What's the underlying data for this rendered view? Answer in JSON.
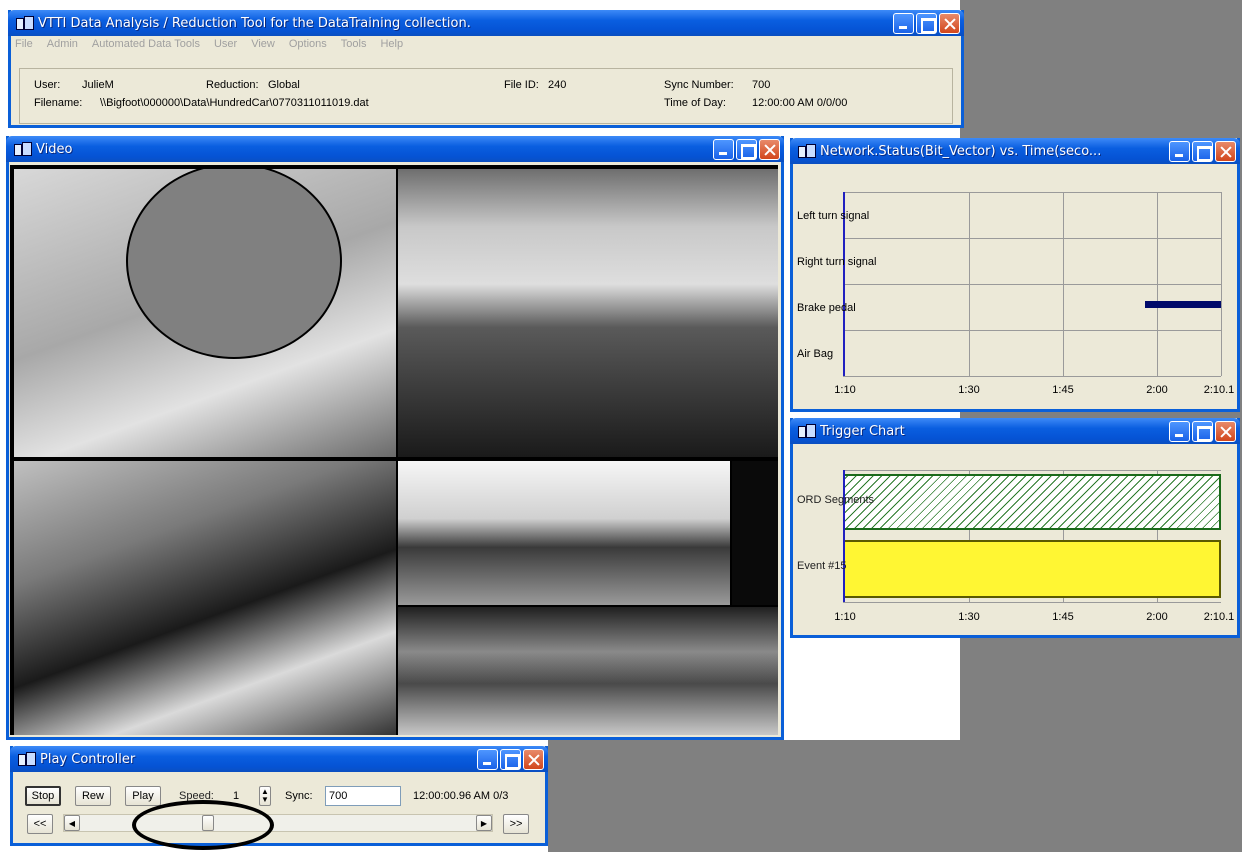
{
  "main": {
    "title": "VTTI Data Analysis / Reduction Tool for the DataTraining collection.",
    "menu": [
      "File",
      "Admin",
      "Automated Data Tools",
      "User",
      "View",
      "Options",
      "Tools",
      "Help"
    ],
    "user_label": "User:",
    "user_value": "JulieM",
    "reduction_label": "Reduction:",
    "reduction_value": "Global",
    "fileid_label": "File ID:",
    "fileid_value": "240",
    "sync_label": "Sync Number:",
    "sync_value": "700",
    "filename_label": "Filename:",
    "filename_value": "\\\\Bigfoot\\000000\\Data\\HundredCar\\0770311011019.dat",
    "tod_label": "Time of Day:",
    "tod_value": "12:00:00 AM  0/0/00"
  },
  "video": {
    "title": "Video"
  },
  "network": {
    "title": "Network.Status(Bit_Vector) vs. Time(seco...",
    "rows": [
      "Left turn signal",
      "Right turn signal",
      "Brake pedal",
      "Air Bag"
    ],
    "xticks": [
      "1:10",
      "1:30",
      "1:45",
      "2:00",
      "2:10.1"
    ],
    "bar_color": "#000a6a"
  },
  "trigger": {
    "title": "Trigger Chart",
    "rows": [
      "ORD Segments",
      "Event #15"
    ],
    "xticks": [
      "1:10",
      "1:30",
      "1:45",
      "2:00",
      "2:10.1"
    ],
    "segment_color": "#2a7a2a",
    "event_color": "#fff633"
  },
  "chart_data": [
    {
      "type": "bar",
      "x_ticks": [
        "1:10",
        "1:30",
        "1:45",
        "2:00",
        "2:10.1"
      ],
      "categories": [
        "Left turn signal",
        "Right turn signal",
        "Brake pedal",
        "Air Bag"
      ],
      "series": [
        {
          "name": "Brake pedal",
          "start": "1:59",
          "end": "2:10.1"
        }
      ]
    },
    {
      "type": "bar",
      "x_ticks": [
        "1:10",
        "1:30",
        "1:45",
        "2:00",
        "2:10.1"
      ],
      "categories": [
        "ORD Segments",
        "Event #15"
      ],
      "series": [
        {
          "name": "ORD Segments",
          "start": "1:10",
          "end": "2:10.1"
        },
        {
          "name": "Event #15",
          "start": "1:10",
          "end": "2:10.1"
        }
      ]
    }
  ],
  "play": {
    "title": "Play Controller",
    "stop": "Stop",
    "rew": "Rew",
    "play": "Play",
    "speed_label": "Speed:",
    "speed_value": "1",
    "sync_label": "Sync:",
    "sync_value": "700",
    "time_status": "12:00:00.96 AM  0/3",
    "fast_back": "<<",
    "fast_forward": ">>"
  }
}
